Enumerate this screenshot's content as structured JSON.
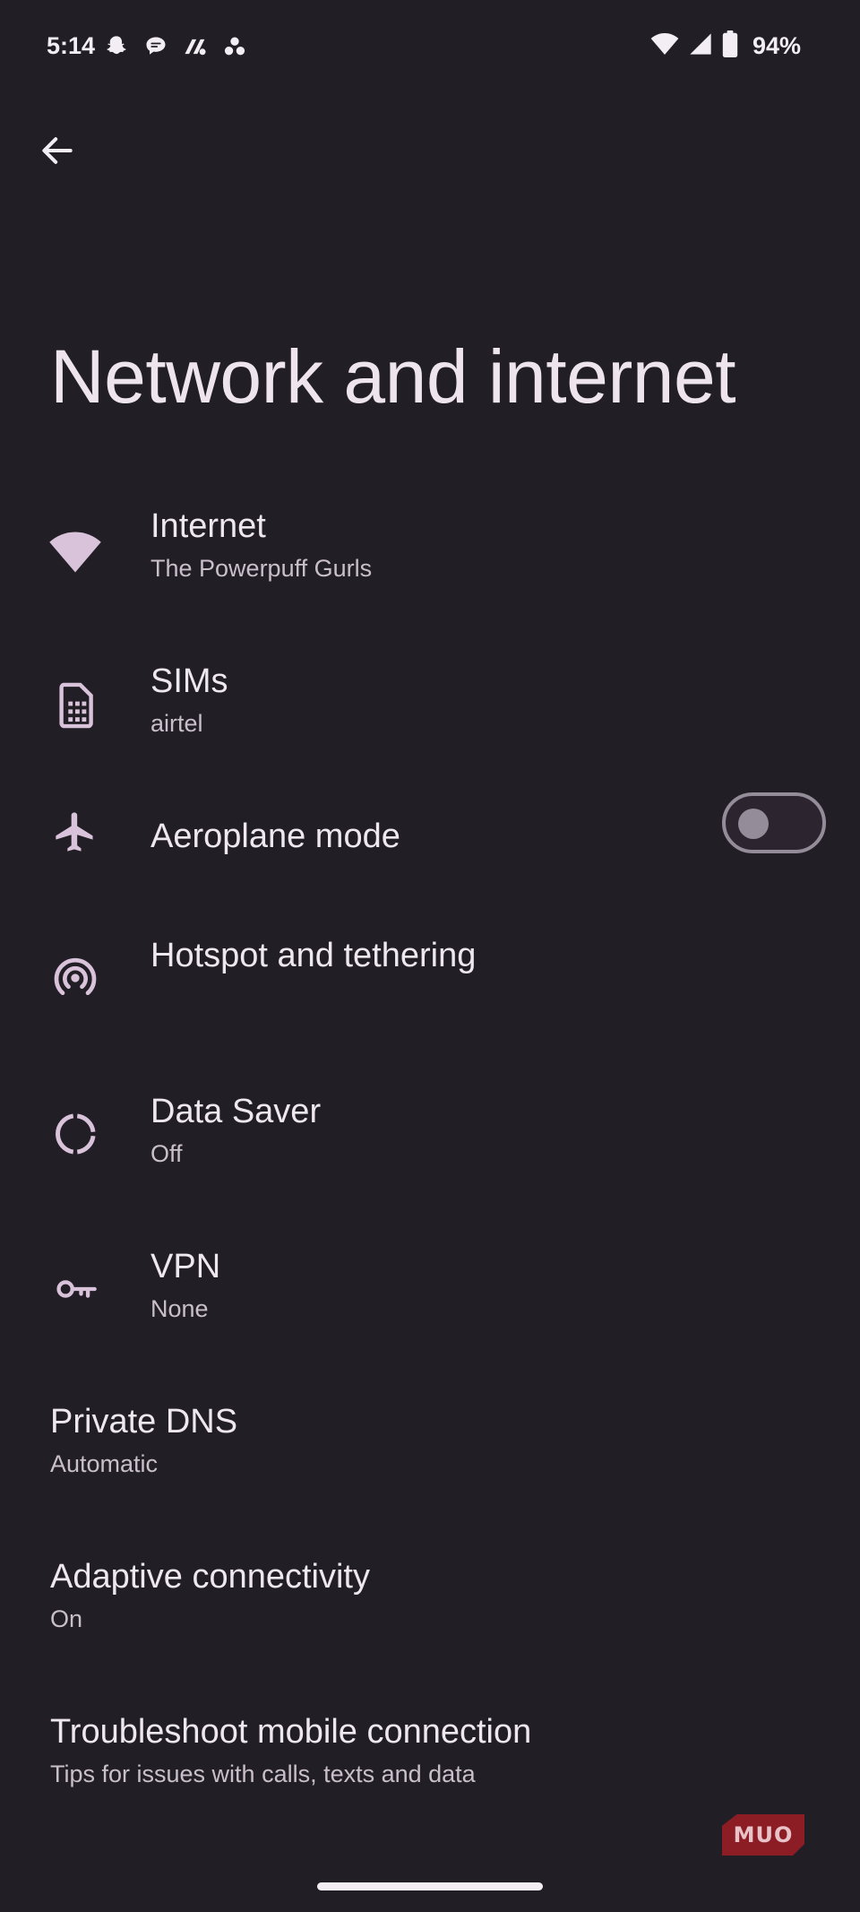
{
  "theme": {
    "background": "#221e25",
    "icon_color": "#d8c3da",
    "text_primary": "#efe7f0",
    "text_secondary": "#c9bfcb"
  },
  "status_bar": {
    "time": "5:14",
    "notification_icons": [
      "snapchat-icon",
      "chat-bubble-icon",
      "teams-icon",
      "dots-cluster-icon"
    ],
    "system_icons": [
      "wifi-icon",
      "cellular-signal-icon",
      "battery-icon"
    ],
    "battery_percent": "94%"
  },
  "page_title": "Network and internet",
  "items": [
    {
      "title": "Internet",
      "summary": "The Powerpuff Gurls",
      "icon": "wifi-icon"
    },
    {
      "title": "SIMs",
      "summary": "airtel",
      "icon": "sim-card-icon"
    },
    {
      "title": "Aeroplane mode",
      "icon": "airplane-icon",
      "toggle": false
    },
    {
      "title": "Hotspot and tethering",
      "icon": "hotspot-icon"
    },
    {
      "title": "Data Saver",
      "summary": "Off",
      "icon": "data-saver-icon"
    },
    {
      "title": "VPN",
      "summary": "None",
      "icon": "vpn-key-icon"
    },
    {
      "title": "Private DNS",
      "summary": "Automatic"
    },
    {
      "title": "Adaptive connectivity",
      "summary": "On"
    },
    {
      "title": "Troubleshoot mobile connection",
      "summary": "Tips for issues with calls, texts and data"
    }
  ],
  "watermark": "MUO"
}
